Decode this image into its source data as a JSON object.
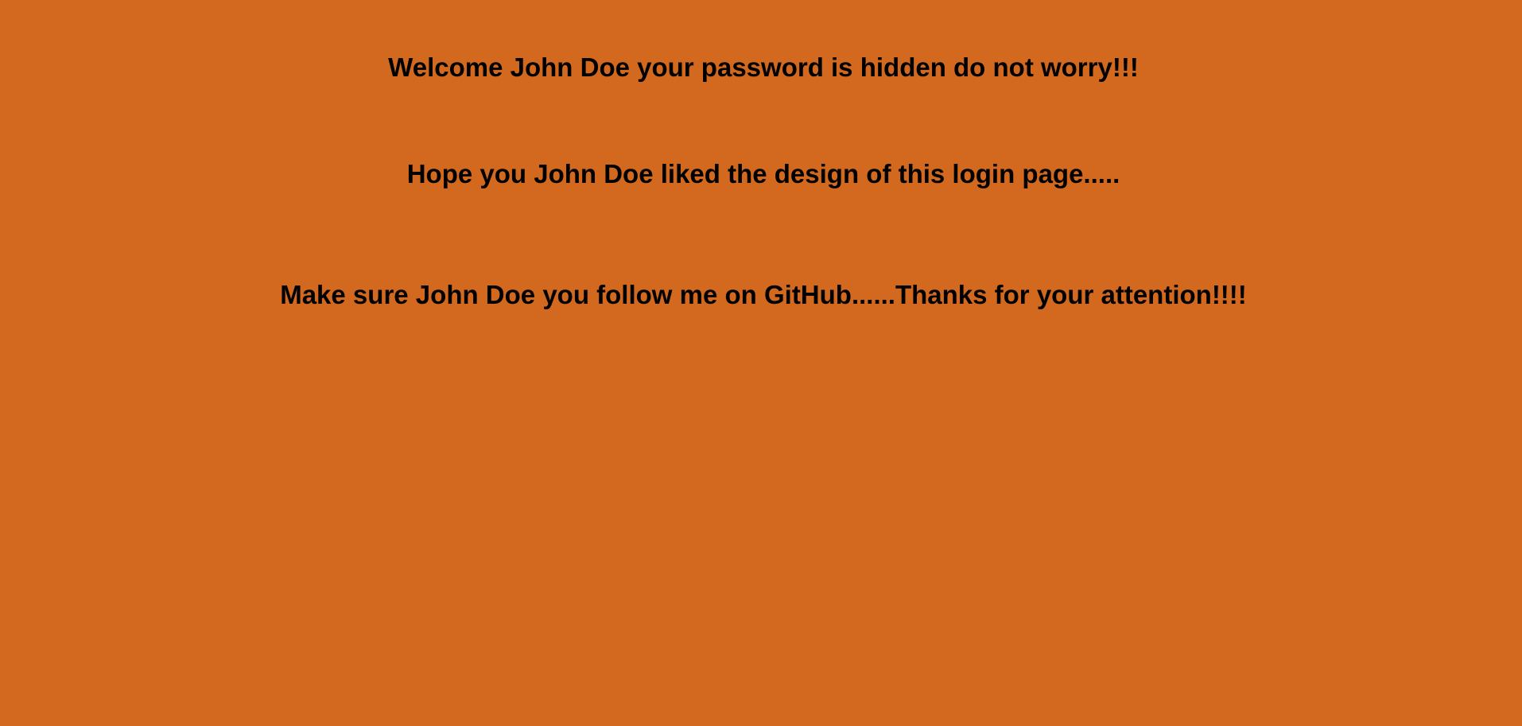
{
  "page": {
    "background_color": "#d2691e",
    "text_color": "#000000"
  },
  "messages": {
    "welcome": "Welcome John Doe your password is hidden do not worry!!!",
    "hope": "Hope you John Doe liked the design of this login page.....",
    "follow": "Make sure John Doe you follow me on GitHub......Thanks for your attention!!!!"
  }
}
